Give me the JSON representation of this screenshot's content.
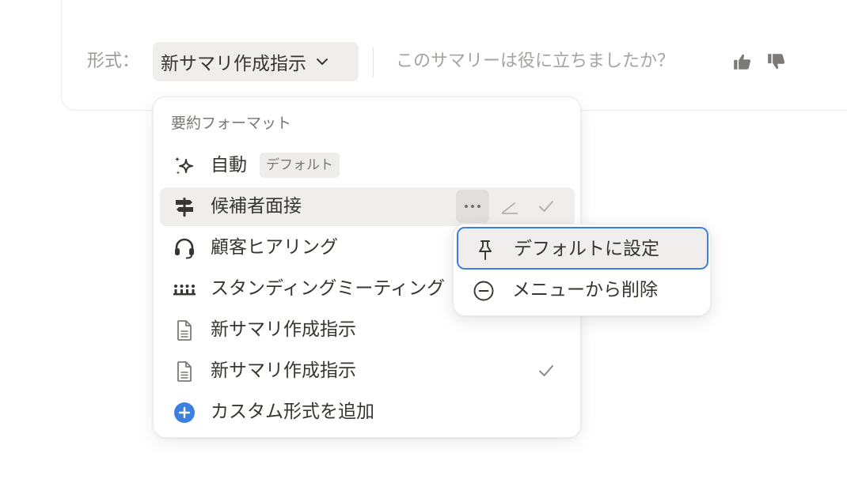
{
  "toolbar": {
    "format_label": "形式：",
    "selected_format": "新サマリ作成指示",
    "feedback_question": "このサマリーは役に立ちましたか？"
  },
  "menu": {
    "header": "要約フォーマット",
    "items": [
      {
        "label": "自動",
        "badge": "デフォルト",
        "icon": "sparkles-icon"
      },
      {
        "label": "候補者面接",
        "icon": "signpost-icon"
      },
      {
        "label": "顧客ヒアリング",
        "icon": "headset-icon"
      },
      {
        "label": "スタンディングミーティング",
        "icon": "team-icon"
      },
      {
        "label": "新サマリ作成指示",
        "icon": "document-icon"
      },
      {
        "label": "新サマリ作成指示",
        "icon": "document-icon",
        "selected": true
      },
      {
        "label": "カスタム形式を追加",
        "icon": "plus-circle-icon"
      }
    ]
  },
  "submenu": {
    "items": [
      {
        "label": "デフォルトに設定",
        "icon": "pin-icon"
      },
      {
        "label": "メニューから削除",
        "icon": "minus-circle-icon"
      }
    ]
  },
  "colors": {
    "accent": "#3d7fe0",
    "hover": "#efeeec",
    "text": "#37352f",
    "muted": "#9b9a97"
  }
}
